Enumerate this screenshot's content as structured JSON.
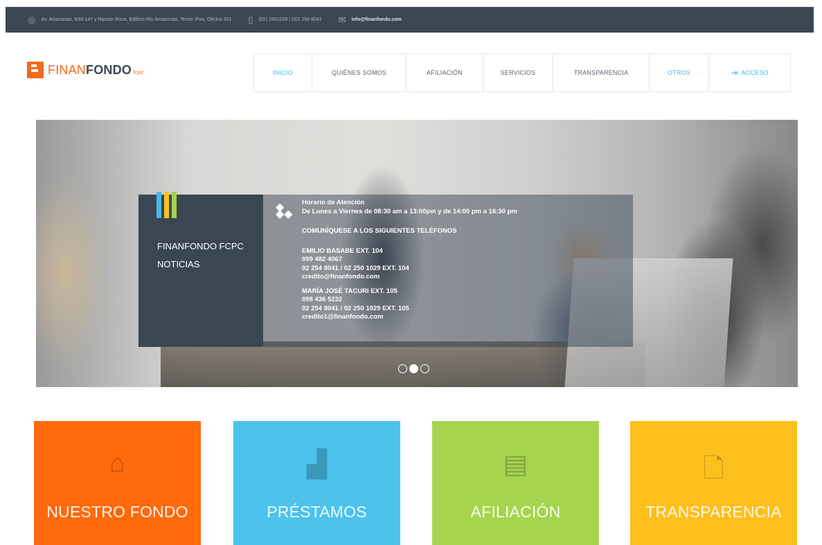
{
  "topbar": {
    "address": "Av. Amazonas, N33-147 y Ramón Roca, Edificio Río Amazonas, Tercer Piso, Oficina 301",
    "phone": "(02) 2501029 / (02) 254 8041",
    "email": "info@finanfondo.com"
  },
  "logo": {
    "part1": "FINAN",
    "part2": "FONDO",
    "part3": "fcpc"
  },
  "nav": {
    "items": [
      "INICIO",
      "QUIÉNES SOMOS",
      "AFILIACIÓN",
      "SERVICIOS",
      "TRANSPARENCIA",
      "OTROS",
      "ACCESO"
    ]
  },
  "hero": {
    "card_title_1": "FINANFONDO FCPC",
    "card_title_2": "NOTICIAS",
    "card_bar_colors": [
      "#4ab6e7",
      "#f9c21b",
      "#a6d04d"
    ],
    "schedule_title": "Horario de Atención",
    "schedule_text": "De Lunes a Viernes de 08:30 am a 13:00pm y de 14:00 pm a 16:30 pm",
    "phones_title": "COMUNÍQUESE A LOS SIGUIENTES TELÉFONOS",
    "contact1": {
      "name": "EMILIO BASABE EXT. 104",
      "mobile": "099 482 4067",
      "phones": "02 254 8041 / 02 250 1029 EXT. 104",
      "email": "credito@finanfondo.com"
    },
    "contact2": {
      "name": "MARÍA JOSÉ TACURI EXT. 105",
      "mobile": "098 436 5232",
      "phones": "02 254 8041 / 02 250 1029 EXT. 105",
      "email": "credito1@finanfondo.com"
    },
    "slides": {
      "count": 3,
      "active": 2
    }
  },
  "tiles": [
    {
      "label": "NUESTRO FONDO",
      "icon": "home-icon",
      "color": "#ff6a0d"
    },
    {
      "label": "PRÉSTAMOS",
      "icon": "chart-icon",
      "color": "#4cc3ec"
    },
    {
      "label": "AFILIACIÓN",
      "icon": "id-card-icon",
      "color": "#a6d44f"
    },
    {
      "label": "TRANSPARENCIA",
      "icon": "document-icon",
      "color": "#fdbf1c"
    }
  ],
  "colors": {
    "brand_orange": "#f26a1b",
    "dark": "#3a4753",
    "accent_blue": "#4ab6e7"
  }
}
